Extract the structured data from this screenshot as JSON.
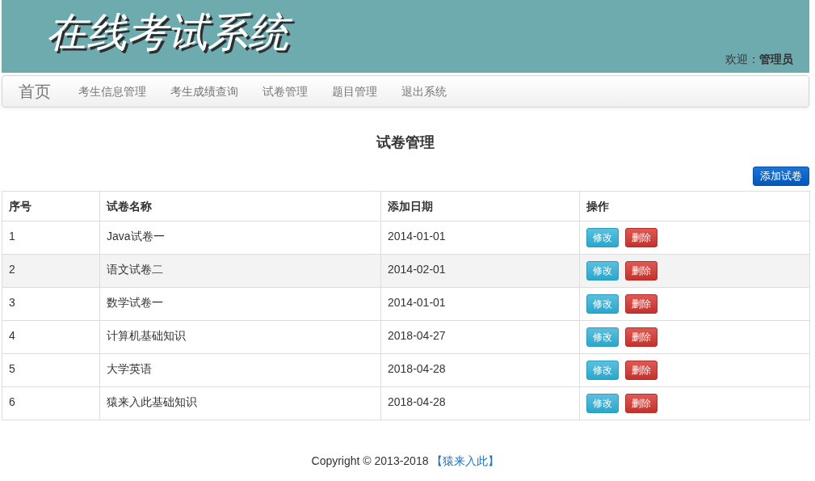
{
  "header": {
    "title": "在线考试系统",
    "welcome": "欢迎：**管理员**"
  },
  "navbar": {
    "brand": "首页",
    "items": [
      "考生信息管理",
      "考生成绩查询",
      "试卷管理",
      "题目管理",
      "退出系统"
    ]
  },
  "page": {
    "heading": "试卷管理",
    "add_button": "添加试卷"
  },
  "table": {
    "columns": [
      "序号",
      "试卷名称",
      "添加日期",
      "操作"
    ],
    "rows": [
      {
        "index": "1",
        "name": "Java试卷一",
        "date": "2014-01-01",
        "hovered": false,
        "actions": [
          {
            "kind": "edit",
            "label": "修改"
          },
          {
            "kind": "delete",
            "label": "删除"
          }
        ]
      },
      {
        "index": "2",
        "name": "语文试卷二",
        "date": "2014-02-01",
        "hovered": true,
        "actions": [
          {
            "kind": "edit",
            "label": "修改"
          },
          {
            "kind": "delete",
            "label": "删除"
          }
        ]
      },
      {
        "index": "3",
        "name": "数学试卷一",
        "date": "2014-01-01",
        "hovered": false,
        "actions": [
          {
            "kind": "edit",
            "label": "修改"
          },
          {
            "kind": "delete",
            "label": "删除"
          }
        ]
      },
      {
        "index": "4",
        "name": "计算机基础知识",
        "date": "2018-04-27",
        "hovered": false,
        "actions": [
          {
            "kind": "edit",
            "label": "修改"
          },
          {
            "kind": "delete",
            "label": "删除"
          }
        ]
      },
      {
        "index": "5",
        "name": "大学英语",
        "date": "2018-04-28",
        "hovered": false,
        "actions": [
          {
            "kind": "edit",
            "label": "修改"
          },
          {
            "kind": "delete",
            "label": "删除"
          }
        ]
      },
      {
        "index": "6",
        "name": "猿来入此基础知识",
        "date": "2018-04-28",
        "hovered": false,
        "actions": [
          {
            "kind": "edit",
            "label": "修改"
          },
          {
            "kind": "delete",
            "label": "删除"
          }
        ]
      }
    ]
  },
  "footer": {
    "copyright": "Copyright © 2013-2018",
    "link": "【猿来入此】"
  }
}
